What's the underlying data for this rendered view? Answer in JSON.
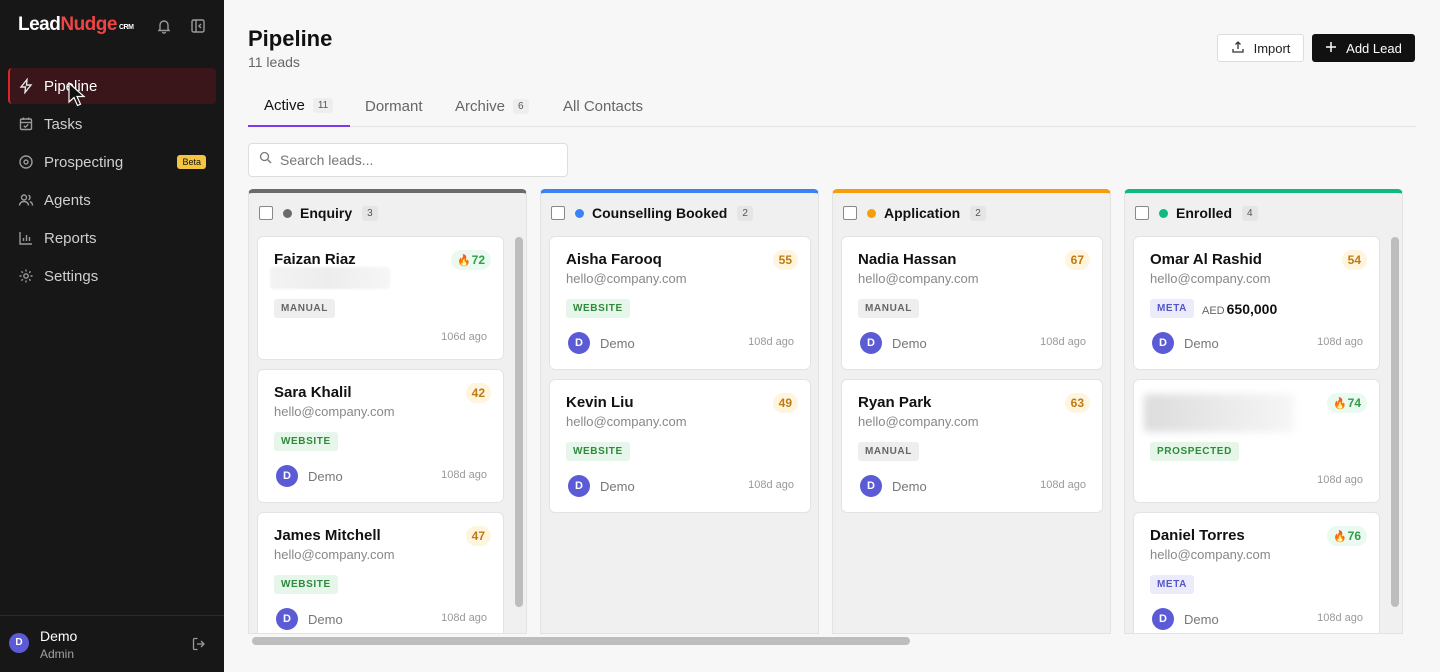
{
  "app": {
    "logo_lead": "Lead",
    "logo_nudge": "Nudge",
    "logo_crm": "CRM"
  },
  "sidebar": {
    "items": [
      {
        "label": "Pipeline",
        "icon": "lightning-icon"
      },
      {
        "label": "Tasks",
        "icon": "calendar-check-icon"
      },
      {
        "label": "Prospecting",
        "icon": "target-icon",
        "badge": "Beta"
      },
      {
        "label": "Agents",
        "icon": "users-icon"
      },
      {
        "label": "Reports",
        "icon": "bar-chart-icon"
      },
      {
        "label": "Settings",
        "icon": "gear-icon"
      }
    ],
    "user": {
      "initial": "D",
      "name": "Demo",
      "role": "Admin"
    }
  },
  "header": {
    "title": "Pipeline",
    "subtitle": "11 leads",
    "import_label": "Import",
    "add_label": "Add Lead"
  },
  "tabs": [
    {
      "label": "Active",
      "count": "11"
    },
    {
      "label": "Dormant",
      "count": ""
    },
    {
      "label": "Archive",
      "count": "6"
    },
    {
      "label": "All Contacts",
      "count": ""
    }
  ],
  "search": {
    "placeholder": "Search leads..."
  },
  "colors": {
    "accent": "#7c3aed",
    "brand": "#ef4444",
    "enquiry": "#6b6b6b",
    "counselling": "#3b82f6",
    "application": "#f59e0b",
    "enrolled": "#10b981"
  },
  "columns": [
    {
      "title": "Enquiry",
      "count": "3",
      "cards": [
        {
          "name": "Faizan Riaz",
          "email": "",
          "score": "72",
          "hot": true,
          "tag": "MANUAL",
          "owner": "",
          "ago": "106d ago"
        },
        {
          "name": "Sara Khalil",
          "email": "hello@company.com",
          "score": "42",
          "hot": false,
          "tag": "WEBSITE",
          "owner": "Demo",
          "ago": "108d ago"
        },
        {
          "name": "James Mitchell",
          "email": "hello@company.com",
          "score": "47",
          "hot": false,
          "tag": "WEBSITE",
          "owner": "Demo",
          "ago": "108d ago"
        }
      ]
    },
    {
      "title": "Counselling Booked",
      "count": "2",
      "cards": [
        {
          "name": "Aisha Farooq",
          "email": "hello@company.com",
          "score": "55",
          "hot": false,
          "tag": "WEBSITE",
          "owner": "Demo",
          "ago": "108d ago"
        },
        {
          "name": "Kevin Liu",
          "email": "hello@company.com",
          "score": "49",
          "hot": false,
          "tag": "WEBSITE",
          "owner": "Demo",
          "ago": "108d ago"
        }
      ]
    },
    {
      "title": "Application",
      "count": "2",
      "cards": [
        {
          "name": "Nadia Hassan",
          "email": "hello@company.com",
          "score": "67",
          "hot": false,
          "tag": "MANUAL",
          "owner": "Demo",
          "ago": "108d ago"
        },
        {
          "name": "Ryan Park",
          "email": "hello@company.com",
          "score": "63",
          "hot": false,
          "tag": "MANUAL",
          "owner": "Demo",
          "ago": "108d ago"
        }
      ]
    },
    {
      "title": "Enrolled",
      "count": "4",
      "cards": [
        {
          "name": "Omar Al Rashid",
          "email": "hello@company.com",
          "score": "54",
          "hot": false,
          "tag": "META",
          "currency": "AED",
          "amount": "650,000",
          "owner": "Demo",
          "ago": "108d ago"
        },
        {
          "name": "",
          "email": "",
          "score": "74",
          "hot": true,
          "tag": "PROSPECTED",
          "owner": "",
          "ago": "108d ago"
        },
        {
          "name": "Daniel Torres",
          "email": "hello@company.com",
          "score": "76",
          "hot": true,
          "tag": "META",
          "owner": "Demo",
          "ago": "108d ago"
        }
      ]
    }
  ]
}
